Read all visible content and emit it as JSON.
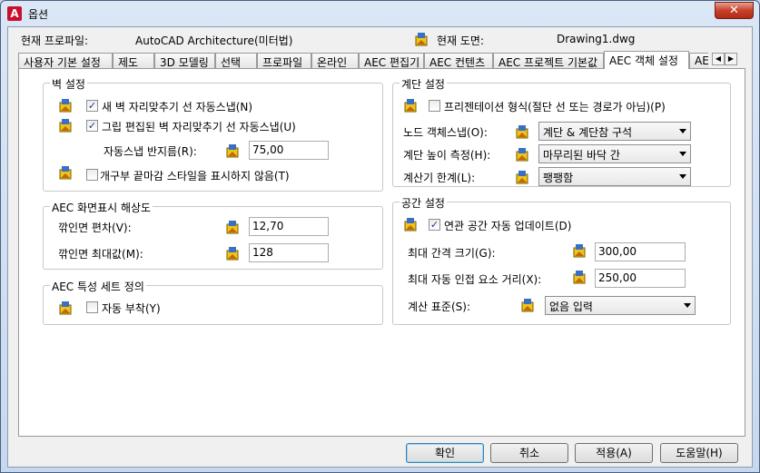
{
  "window": {
    "title": "옵션",
    "close": "✕"
  },
  "header": {
    "profile_label": "현재 프로파일:",
    "profile_value": "AutoCAD Architecture(미터법)",
    "drawing_label": "현재 도면:",
    "drawing_value": "Drawing1.dwg"
  },
  "tabs": [
    {
      "label": "사용자 기본 설정"
    },
    {
      "label": "제도"
    },
    {
      "label": "3D 모델링"
    },
    {
      "label": "선택"
    },
    {
      "label": "프로파일"
    },
    {
      "label": "온라인"
    },
    {
      "label": "AEC 편집기"
    },
    {
      "label": "AEC 컨텐츠"
    },
    {
      "label": "AEC 프로젝트 기본값"
    },
    {
      "label": "AEC 객체 설정"
    },
    {
      "label": "AEC"
    }
  ],
  "active_tab": "AEC 객체 설정",
  "wall": {
    "title": "벽 설정",
    "autosnap_new": {
      "label": "새 벽 자리맞추기 선 자동스냅(N)",
      "checked": true
    },
    "autosnap_grip": {
      "label": "그립 편집된 벽 자리맞추기 선 자동스냅(U)",
      "checked": true
    },
    "radius_label": "자동스냅 반지름(R):",
    "radius_value": "75,00",
    "opening_endcap": {
      "label": "개구부 끝마감 스타일을 표시하지 않음(T)",
      "checked": false
    }
  },
  "display": {
    "title": "AEC 화면표시 해상도",
    "facet_dev_label": "깎인면 편차(V):",
    "facet_dev_value": "12,70",
    "facet_max_label": "깎인면 최대값(M):",
    "facet_max_value": "128"
  },
  "propset": {
    "title": "AEC 특성 세트 정의",
    "auto_attach": {
      "label": "자동 부착(Y)",
      "checked": false
    }
  },
  "stair": {
    "title": "계단 설정",
    "presentation": {
      "label": "프리젠테이션 형식(절단 선 또는 경로가 아님)(P)",
      "checked": false
    },
    "node_snap_label": "노드 객체스냅(O):",
    "node_snap_value": "계단 & 계단참 구석",
    "height_label": "계단 높이 측정(H):",
    "height_value": "마무리된 바닥 간",
    "calc_label": "계산기 한계(L):",
    "calc_value": "팽팽함"
  },
  "space": {
    "title": "공간 설정",
    "auto_update": {
      "label": "연관 공간 자동 업데이트(D)",
      "checked": true
    },
    "gap_label": "최대 간격 크기(G):",
    "gap_value": "300,00",
    "adjacent_label": "최대 자동 인접 요소 거리(X):",
    "adjacent_value": "250,00",
    "standard_label": "계산 표준(S):",
    "standard_value": "없음 입력"
  },
  "buttons": {
    "ok": "확인",
    "cancel": "취소",
    "apply": "적용(A)",
    "help": "도움말(H)"
  },
  "icons": {
    "setting": "drawing-setting-icon"
  },
  "colors": {
    "checkmark": "#1a3d7a",
    "accent": "#3c7fb1",
    "close": "#c7402c"
  }
}
